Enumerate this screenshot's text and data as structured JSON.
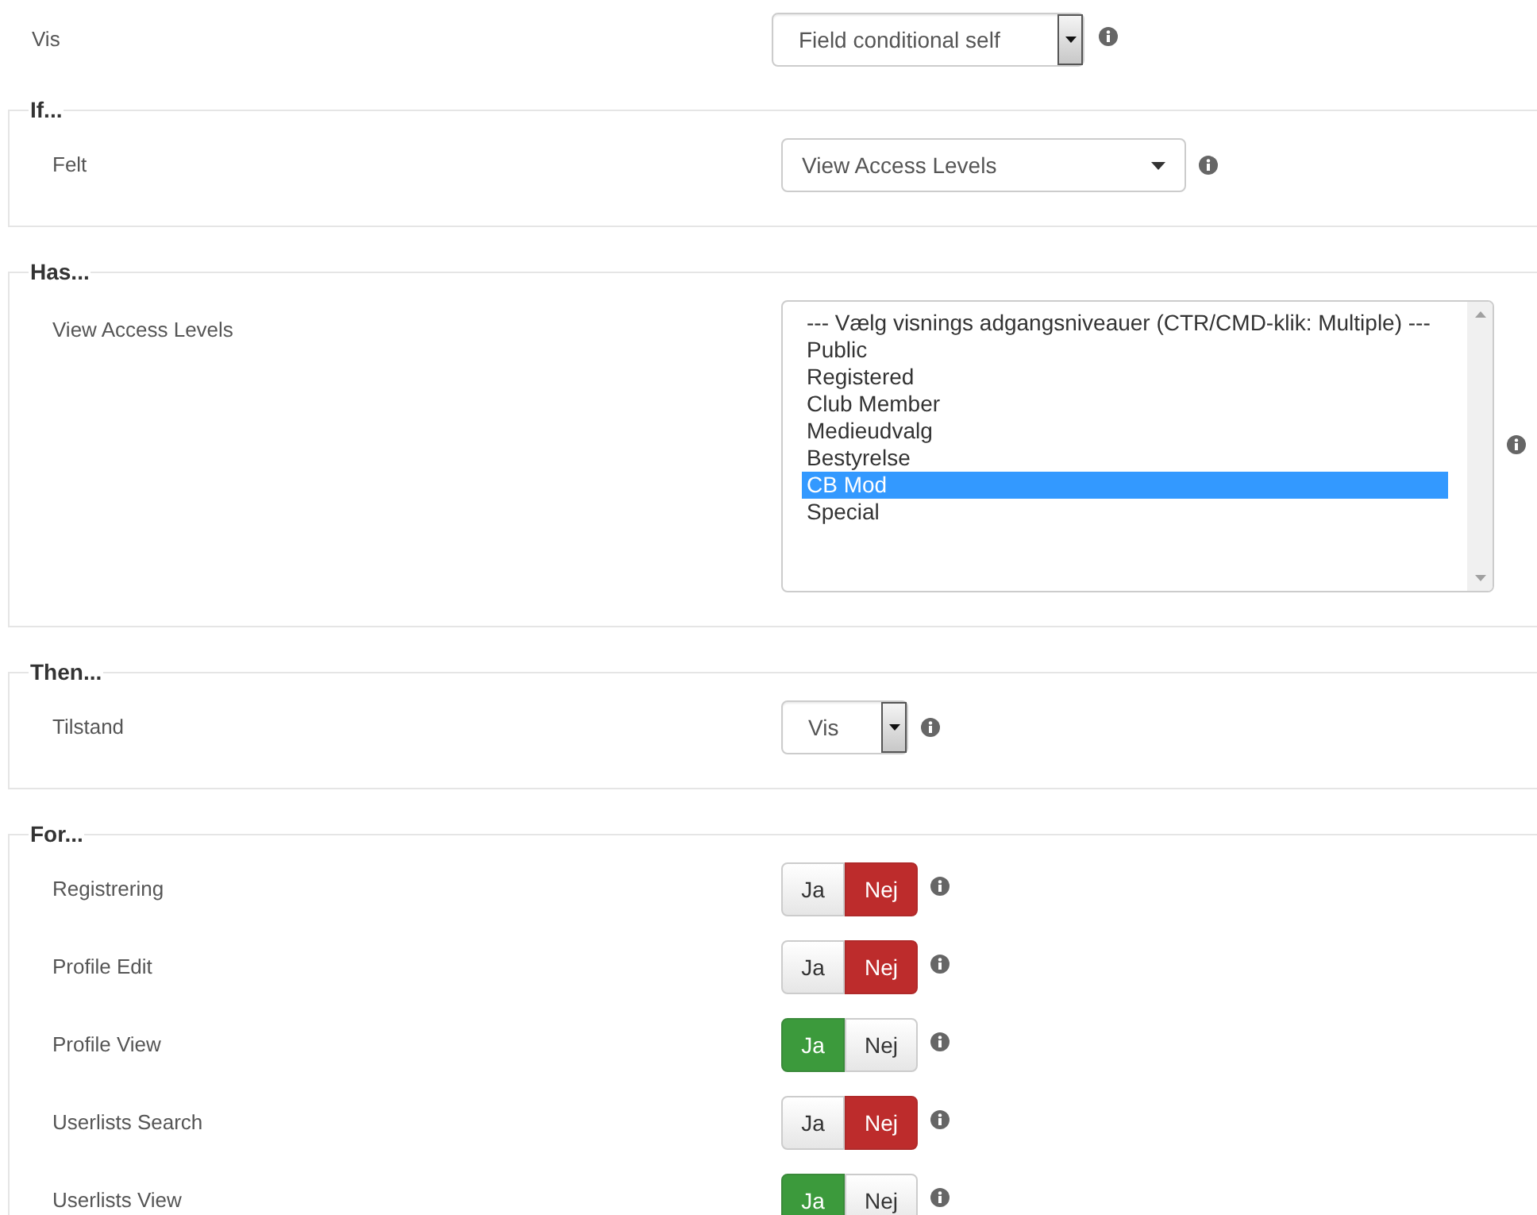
{
  "top": {
    "label": "Vis",
    "select": {
      "value": "Field conditional self",
      "kind": "button"
    }
  },
  "sections": [
    {
      "legend": "If...",
      "rows": [
        {
          "kind": "select",
          "label": "Felt",
          "select": {
            "value": "View Access Levels",
            "kind": "caret"
          }
        }
      ]
    },
    {
      "legend": "Has...",
      "rows": [
        {
          "kind": "listbox",
          "label": "View Access Levels",
          "options": [
            {
              "label": "--- Vælg visnings adgangsniveauer (CTR/CMD-klik: Multiple) ---",
              "selected": false
            },
            {
              "label": "Public",
              "selected": false
            },
            {
              "label": "Registered",
              "selected": false
            },
            {
              "label": "Club Member",
              "selected": false
            },
            {
              "label": "Medieudvalg",
              "selected": false
            },
            {
              "label": "Bestyrelse",
              "selected": false
            },
            {
              "label": "CB Mod",
              "selected": true
            },
            {
              "label": "Special",
              "selected": false
            }
          ]
        }
      ]
    },
    {
      "legend": "Then...",
      "rows": [
        {
          "kind": "select",
          "label": "Tilstand",
          "select": {
            "value": "Vis",
            "kind": "button"
          }
        }
      ]
    },
    {
      "legend": "For...",
      "rows": [
        {
          "kind": "toggle",
          "label": "Registrering",
          "options": [
            {
              "label": "Ja",
              "kind": "yes",
              "selected": false
            },
            {
              "label": "Nej",
              "kind": "no",
              "selected": true
            }
          ]
        },
        {
          "kind": "toggle",
          "label": "Profile Edit",
          "options": [
            {
              "label": "Ja",
              "kind": "yes",
              "selected": false
            },
            {
              "label": "Nej",
              "kind": "no",
              "selected": true
            }
          ]
        },
        {
          "kind": "toggle",
          "label": "Profile View",
          "options": [
            {
              "label": "Ja",
              "kind": "yes",
              "selected": true
            },
            {
              "label": "Nej",
              "kind": "no",
              "selected": false
            }
          ]
        },
        {
          "kind": "toggle",
          "label": "Userlists Search",
          "options": [
            {
              "label": "Ja",
              "kind": "yes",
              "selected": false
            },
            {
              "label": "Nej",
              "kind": "no",
              "selected": true
            }
          ]
        },
        {
          "kind": "toggle",
          "label": "Userlists View",
          "options": [
            {
              "label": "Ja",
              "kind": "yes",
              "selected": true
            },
            {
              "label": "Nej",
              "kind": "no",
              "selected": false
            }
          ]
        }
      ]
    }
  ]
}
